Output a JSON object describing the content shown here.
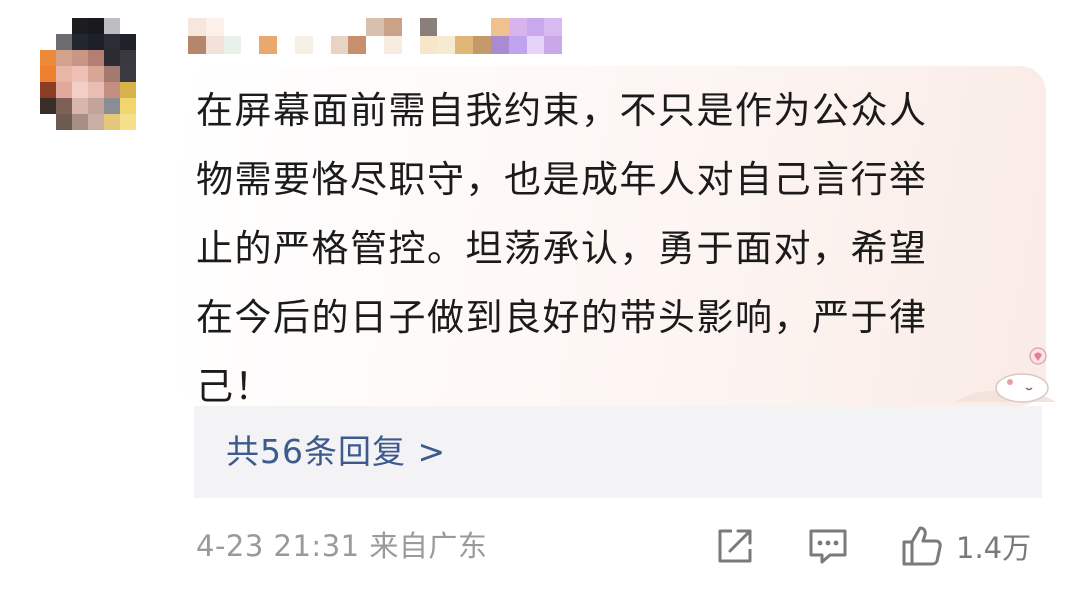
{
  "comment": {
    "text": "在屏幕面前需自我约束，不只是作为公众人\n物需要恪尽职守，也是成年人对自己言行举\n止的严格管控。坦荡承认，勇于面对，希望\n在今后的日子做到良好的带头影响，严于律\n己！"
  },
  "replies": {
    "label": "共56条回复 >"
  },
  "meta": {
    "time_location": "4-23 21:31 来自广东"
  },
  "actions": {
    "like_count": "1.4万"
  },
  "icons": [
    "share-icon",
    "comment-icon",
    "thumbs-up-icon"
  ],
  "colors": {
    "link": "#3d5a8d",
    "meta": "#9a9a9a",
    "icon": "#7a7a7a",
    "reply_bg": "#f3f3f5"
  }
}
